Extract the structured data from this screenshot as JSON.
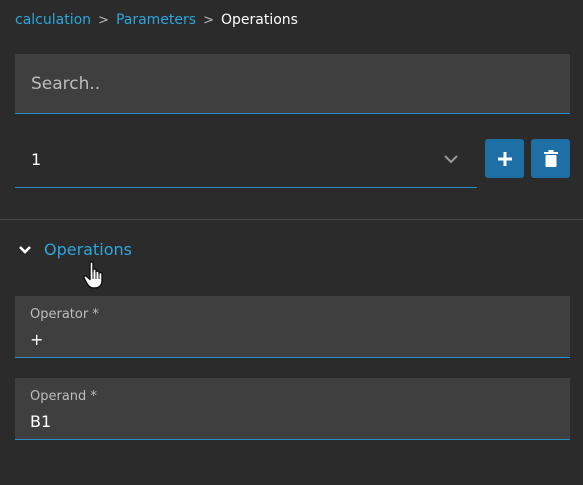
{
  "breadcrumb": {
    "items": [
      "calculation",
      "Parameters"
    ],
    "current": "Operations",
    "separator": ">"
  },
  "search": {
    "placeholder": "Search.."
  },
  "selector": {
    "value": "1"
  },
  "toolbar": {
    "add_icon": "plus-icon",
    "delete_icon": "trash-icon"
  },
  "section": {
    "title": "Operations",
    "expanded": true
  },
  "fields": {
    "operator": {
      "label": "Operator *",
      "value": "+"
    },
    "operand": {
      "label": "Operand *",
      "value": "B1"
    }
  },
  "colors": {
    "accent": "#2ba6de",
    "button": "#1e6fa5",
    "background": "#2b2b2b",
    "field": "#3f3f3f"
  }
}
